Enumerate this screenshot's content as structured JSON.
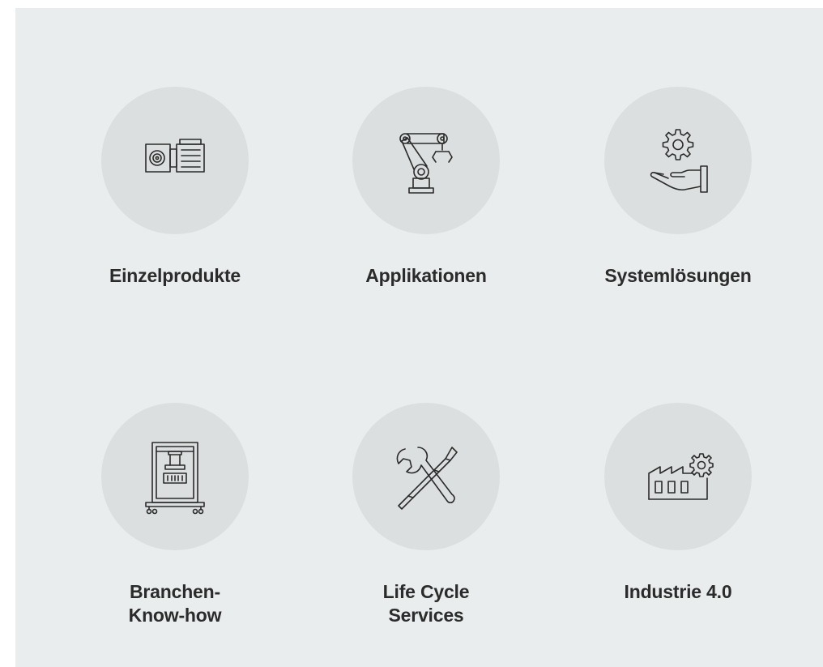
{
  "tiles": [
    {
      "label": "Einzelprodukte",
      "icon": "gear-motor-icon"
    },
    {
      "label": "Applikationen",
      "icon": "robot-arm-icon"
    },
    {
      "label": "Systemlösungen",
      "icon": "hand-gear-icon"
    },
    {
      "label": "Branchen-\nKnow-how",
      "icon": "press-machine-icon"
    },
    {
      "label": "Life Cycle\nServices",
      "icon": "wrench-screwdriver-icon"
    },
    {
      "label": "Industrie 4.0",
      "icon": "factory-gear-icon"
    }
  ],
  "colors": {
    "panel_background": "#eaeded",
    "circle_background": "#dcdfdf",
    "text": "#2b2b2b"
  }
}
